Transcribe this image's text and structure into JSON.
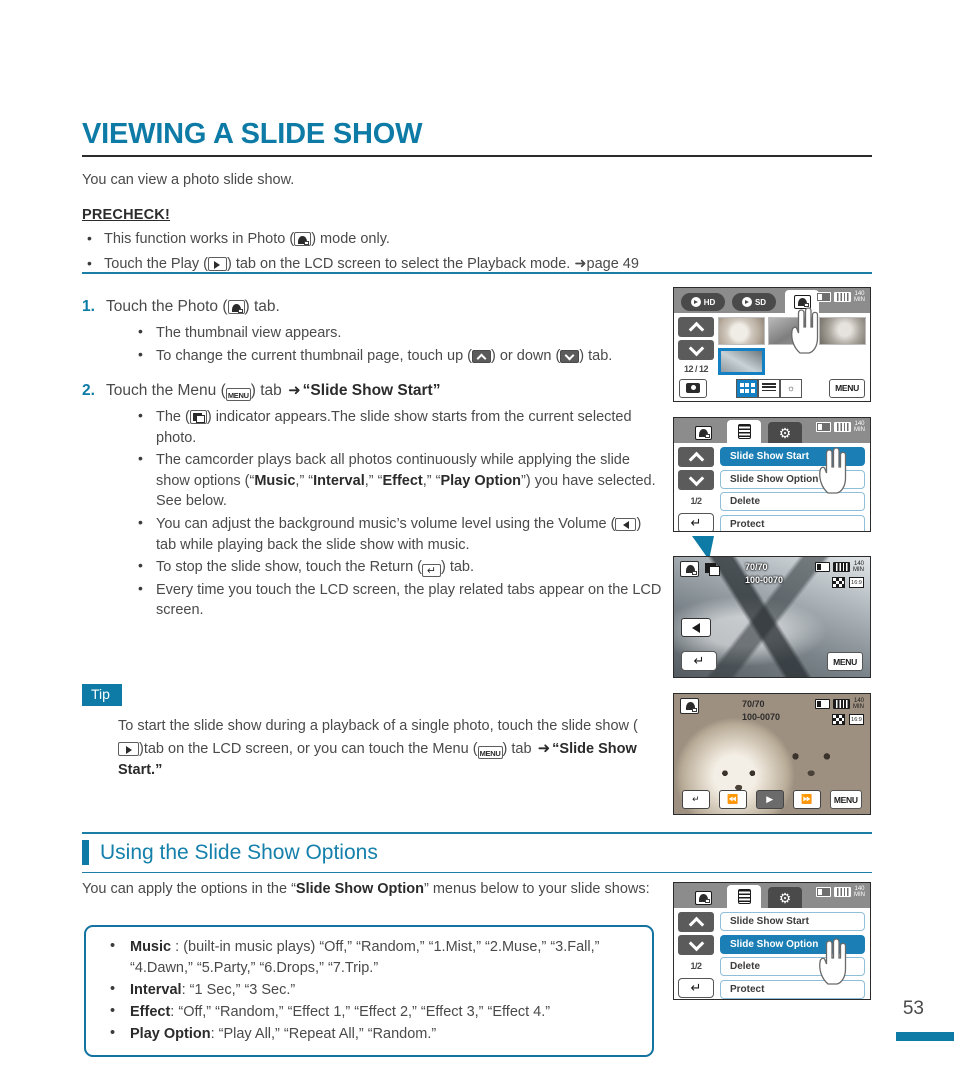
{
  "page": {
    "number": "53",
    "title": "VIEWING A SLIDE SHOW",
    "intro": "You can view a photo slide show.",
    "accent_color": "#0d7ba6",
    "rule_color": "#1b7fa5"
  },
  "precheck": {
    "heading": "PRECHECK!",
    "items": [
      {
        "pre": "This function works in Photo (",
        "icon": "photo-mode-icon",
        "post": ") mode only."
      },
      {
        "pre": "Touch the Play (",
        "icon": "play-tab-icon",
        "post": ") tab on the LCD screen to select the Playback mode. ➜page 49"
      }
    ]
  },
  "steps": [
    {
      "num": "1.",
      "text_parts": [
        "Touch the Photo (",
        ") tab."
      ],
      "icon": "photo-mode-icon",
      "bullets": [
        {
          "segments": [
            "The thumbnail view appears."
          ]
        },
        {
          "segments": [
            "To change the current thumbnail page, touch up (",
            ") or down (",
            ") tab."
          ],
          "icons": [
            "up-arrow-icon",
            "down-arrow-icon"
          ]
        }
      ]
    },
    {
      "num": "2.",
      "text_parts": [
        "Touch the Menu (",
        ") tab "
      ],
      "icon": "menu-tab-icon",
      "arrow": "➜",
      "bold_tail": "“Slide Show Start”",
      "bullets": [
        {
          "segments": [
            "The (",
            ") indicator appears.The slide show starts from the current selected photo."
          ],
          "icons": [
            "slide-show-icon"
          ]
        },
        {
          "segments": [
            "The camcorder plays back all photos continuously while applying the slide show options (“",
            "Music",
            ",” “",
            "Interval",
            ",” “",
            "Effect",
            ",” “",
            "Play Option",
            "”) you have selected. See below."
          ]
        },
        {
          "segments": [
            "You can adjust the background music’s volume level using the Volume (",
            ") tab while playing back the slide show with music."
          ],
          "icons": [
            "volume-icon"
          ]
        },
        {
          "segments": [
            "To stop the slide show, touch the Return (",
            ") tab."
          ],
          "icons": [
            "return-icon"
          ]
        },
        {
          "segments": [
            "Every time you touch the LCD screen, the play related tabs appear on the LCD screen."
          ]
        }
      ]
    }
  ],
  "step2_bold": {
    "music": "Music",
    "interval": "Interval",
    "effect": "Effect",
    "play_option": "Play Option"
  },
  "tip": {
    "badge": "Tip",
    "body_1": "To start the slide show during a playback of a single photo, touch the slide show (",
    "body_2": ")tab on the LCD screen, or you can touch the Menu (",
    "body_3": ") tab ",
    "arrow": "➜",
    "body_bold": "“Slide Show Start.”"
  },
  "section2": {
    "title": "Using the Slide Show Options",
    "intro_1": "You can apply the options in the “",
    "intro_bold": "Slide Show Option",
    "intro_2": "” menus below to your slide shows:",
    "options": [
      {
        "label": "Music",
        "sep": " : ",
        "value": "(built-in music plays) “Off,” “Random,” “1.Mist,” “2.Muse,” “3.Fall,” “4.Dawn,” “5.Party,” “6.Drops,” “7.Trip.”"
      },
      {
        "label": "Interval",
        "sep": ": ",
        "value": "“1 Sec,” “3 Sec.”"
      },
      {
        "label": "Effect",
        "sep": ": ",
        "value": "“Off,” “Random,” “Effect 1,” “Effect 2,” “Effect 3,” “Effect 4.”"
      },
      {
        "label": "Play Option",
        "sep": ": ",
        "value": "“Play All,” “Repeat All,” “Random.”"
      }
    ]
  },
  "lcd1": {
    "name": "thumbnail-view-screen",
    "tabs": [
      {
        "label": "HD",
        "icon": "play-circle-icon",
        "selected": false
      },
      {
        "label": "SD",
        "icon": "play-circle-icon",
        "selected": false
      },
      {
        "label": "",
        "icon": "photo-mode-icon",
        "selected": true
      }
    ],
    "status_minutes": "140",
    "status_unit": "MIN",
    "page_counter": "12 / 12",
    "menu_label": "MENU",
    "thumb_count": 6,
    "active_thumb_index": 3
  },
  "lcd2": {
    "name": "slide-show-menu-screen",
    "tabs": [
      {
        "icon": "photo-mode-icon",
        "selected": false
      },
      {
        "icon": "menu-list-icon",
        "selected": true
      },
      {
        "icon": "gear-icon",
        "selected": false
      }
    ],
    "status_minutes": "140",
    "status_unit": "MIN",
    "page_counter": "1/2",
    "rows": [
      {
        "label": "Slide Show Start",
        "selected": true
      },
      {
        "label": "Slide Show Option",
        "selected": false
      },
      {
        "label": "Delete",
        "selected": false
      },
      {
        "label": "Protect",
        "selected": false
      }
    ]
  },
  "lcd3": {
    "name": "slide-show-playback-screen",
    "counter": "70/70",
    "file_no": "100-0070",
    "status_minutes": "140",
    "status_unit": "MIN",
    "res_label": "16:9",
    "menu_label": "MENU"
  },
  "lcd4": {
    "name": "single-photo-playback-screen",
    "counter": "70/70",
    "file_no": "100-0070",
    "status_minutes": "140",
    "status_unit": "MIN",
    "res_label": "16:9",
    "menu_label": "MENU",
    "controls": [
      "return-icon",
      "prev-icon",
      "slideshow-play-icon",
      "next-icon"
    ]
  },
  "lcd5": {
    "name": "slide-show-option-menu-screen",
    "tabs": [
      {
        "icon": "photo-mode-icon",
        "selected": false
      },
      {
        "icon": "menu-list-icon",
        "selected": true
      },
      {
        "icon": "gear-icon",
        "selected": false
      }
    ],
    "status_minutes": "140",
    "status_unit": "MIN",
    "page_counter": "1/2",
    "rows": [
      {
        "label": "Slide Show Start",
        "selected": false
      },
      {
        "label": "Slide Show Option",
        "selected": true
      },
      {
        "label": "Delete",
        "selected": false
      },
      {
        "label": "Protect",
        "selected": false
      }
    ]
  }
}
